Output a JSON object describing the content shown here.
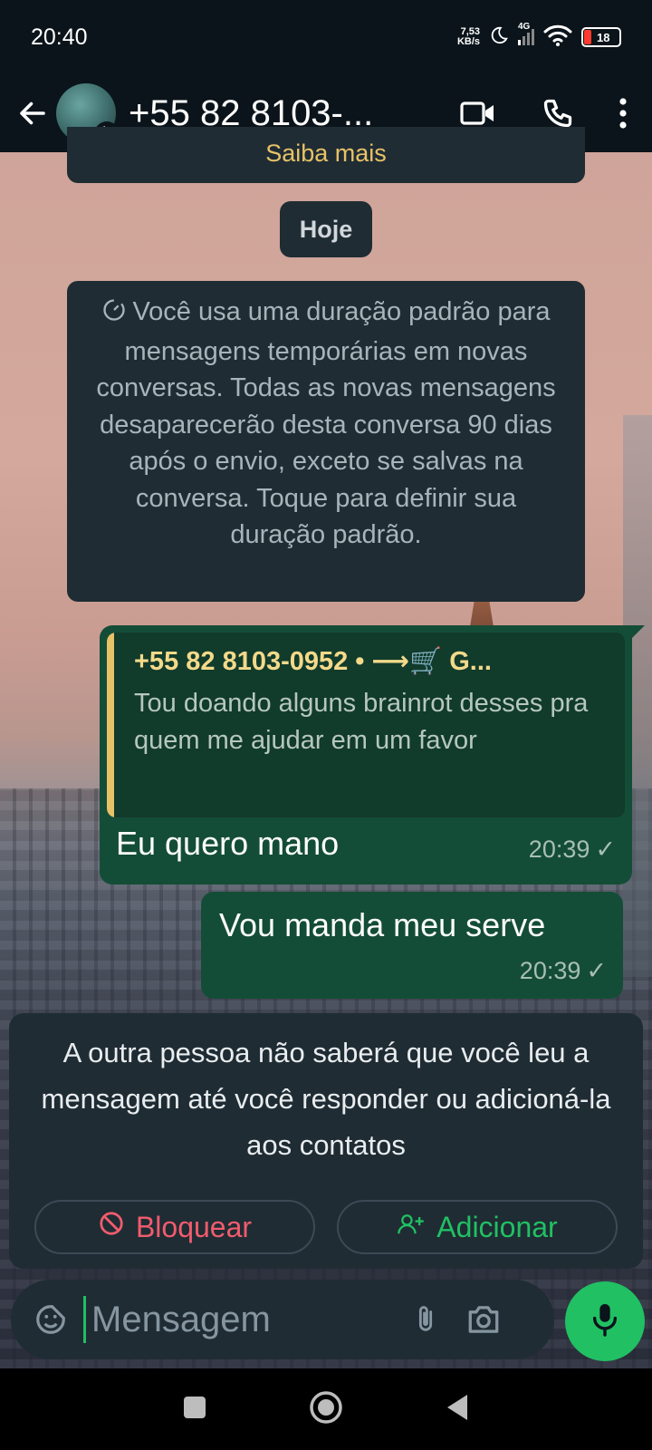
{
  "status_bar": {
    "time": "20:40",
    "net_speed_value": "7,53",
    "net_speed_unit": "KB/s",
    "network": "4G",
    "battery": "18",
    "icons": [
      "moon-icon",
      "signal-icon",
      "wifi-icon",
      "battery-icon"
    ]
  },
  "header": {
    "contact_name": "+55 82 8103-...",
    "icons": [
      "back-arrow-icon",
      "video-call-icon",
      "phone-call-icon",
      "more-options-icon"
    ]
  },
  "chat": {
    "learn_more": "Saiba mais",
    "date_chip": "Hoje",
    "disappearing_notice": "Você usa uma duração padrão para mensagens temporárias em novas conversas. Todas as novas mensagens desaparecerão desta conversa 90 dias após o envio, exceto se salvas na conversa. Toque para definir sua duração padrão.",
    "messages": [
      {
        "quote_author": "+55 82 8103-0952 • ⟶🛒 G...",
        "quote_text": "Tou doando alguns brainrot desses pra quem me ajudar em um favor",
        "text": "Eu quero mano",
        "time": "20:39",
        "status": "✓"
      },
      {
        "text": "Vou manda meu serve",
        "time": "20:39",
        "status": "✓"
      }
    ]
  },
  "unknown_contact_panel": {
    "text": "A outra pessoa não saberá que você leu a mensagem até você responder ou adicioná-la aos contatos",
    "block_label": "Bloquear",
    "add_label": "Adicionar"
  },
  "composer": {
    "placeholder": "Mensagem"
  },
  "colors": {
    "accent_green": "#21c063",
    "outgoing_bubble": "#144d37",
    "panel_bg": "#1f2c34",
    "block_red": "#f15c6d",
    "quote_bar": "#e8c267"
  }
}
